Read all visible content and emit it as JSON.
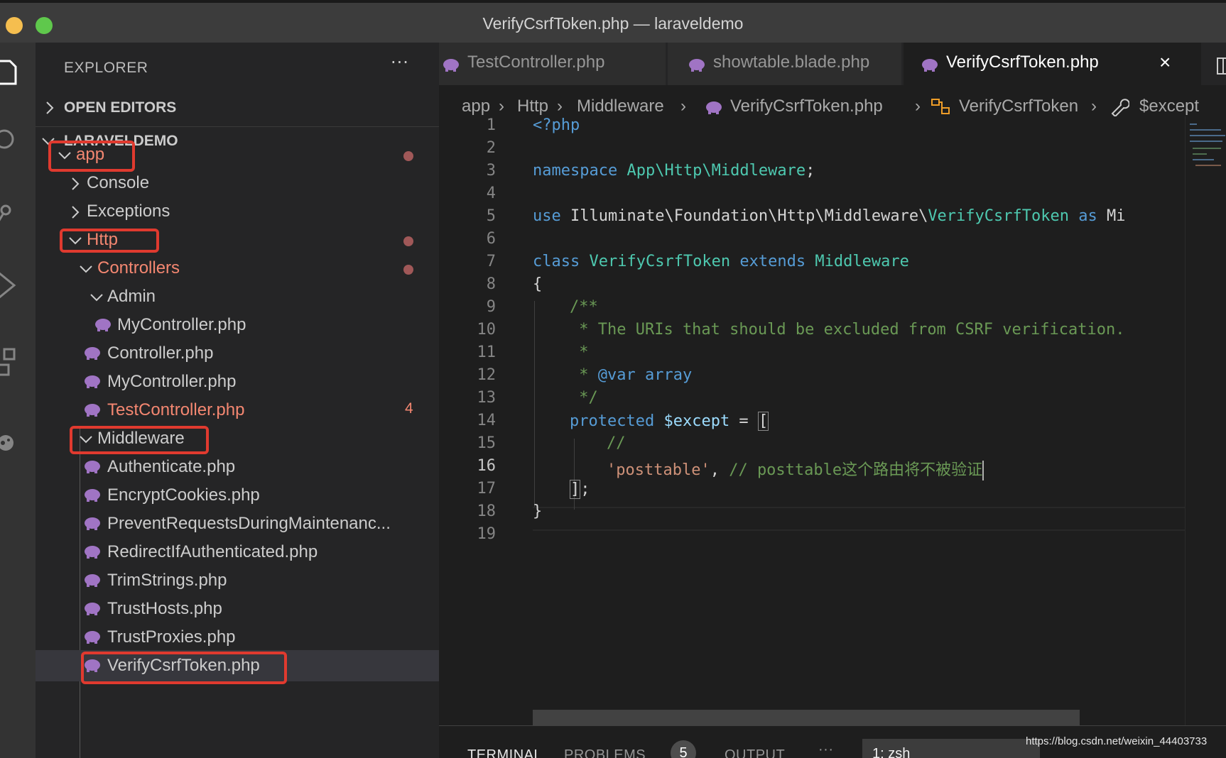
{
  "window": {
    "title": "VerifyCsrfToken.php — laraveldemo"
  },
  "explorer": {
    "title": "EXPLORER",
    "more": "···",
    "open_editors": "OPEN EDITORS",
    "project": "LARAVELDEMO"
  },
  "tree": [
    {
      "label": "app",
      "modified": true
    },
    {
      "label": "Console"
    },
    {
      "label": "Exceptions"
    },
    {
      "label": "Http",
      "modified": true
    },
    {
      "label": "Controllers",
      "modified": true
    },
    {
      "label": "Admin"
    },
    {
      "label": "MyController.php"
    },
    {
      "label": "Controller.php"
    },
    {
      "label": "MyController.php"
    },
    {
      "label": "TestController.php",
      "badge": "4"
    },
    {
      "label": "Middleware"
    },
    {
      "label": "Authenticate.php"
    },
    {
      "label": "EncryptCookies.php"
    },
    {
      "label": "PreventRequestsDuringMaintenanc..."
    },
    {
      "label": "RedirectIfAuthenticated.php"
    },
    {
      "label": "TrimStrings.php"
    },
    {
      "label": "TrustHosts.php"
    },
    {
      "label": "TrustProxies.php"
    },
    {
      "label": "VerifyCsrfToken.php"
    }
  ],
  "tabs": [
    {
      "label": "TestController.php"
    },
    {
      "label": "showtable.blade.php"
    },
    {
      "label": "VerifyCsrfToken.php",
      "close": "×"
    }
  ],
  "breadcrumb": [
    "app",
    "Http",
    "Middleware",
    "VerifyCsrfToken.php",
    "VerifyCsrfToken",
    "$except"
  ],
  "code": {
    "line_numbers": [
      "1",
      "2",
      "3",
      "4",
      "5",
      "6",
      "7",
      "8",
      "9",
      "10",
      "11",
      "12",
      "13",
      "14",
      "15",
      "16",
      "17",
      "18",
      "19"
    ],
    "current_line": 16,
    "l1": "<?php",
    "l3_kw": "namespace",
    "l3_ns": "App\\Http\\Middleware",
    "l3_end": ";",
    "l5_kw": "use",
    "l5_path": " Illuminate\\Foundation\\Http\\Middleware\\",
    "l5_cls": "VerifyCsrfToken",
    "l5_as": "as",
    "l5_alias": "Mi",
    "l7_class": "class",
    "l7_name": "VerifyCsrfToken",
    "l7_extends": "extends",
    "l7_parent": "Middleware",
    "l8": "{",
    "l9": "/**",
    "l10": " * The URIs that should be excluded from CSRF verification.",
    "l11": " *",
    "l12_a": " * ",
    "l12_tag": "@var",
    "l12_type": "array",
    "l13": " */",
    "l14_kw": "protected",
    "l14_var": "$except",
    "l14_op": " = ",
    "l14_br": "[",
    "l15": "//",
    "l16_str": "'posttable'",
    "l16_comma": ", ",
    "l16_cmt": "// posttable这个路由将不被验证",
    "l17_br": "]",
    "l17_end": ";",
    "l18": "}"
  },
  "panel": {
    "terminal": "TERMINAL",
    "problems": "PROBLEMS",
    "problems_count": "5",
    "output": "OUTPUT",
    "more": "···",
    "shell": "1: zsh"
  },
  "watermark": "https://blog.csdn.net/weixin_44403733",
  "colors": {
    "php_icon": "#a074c4",
    "highlight_box": "#e03a2f",
    "modified": "#f48771"
  }
}
